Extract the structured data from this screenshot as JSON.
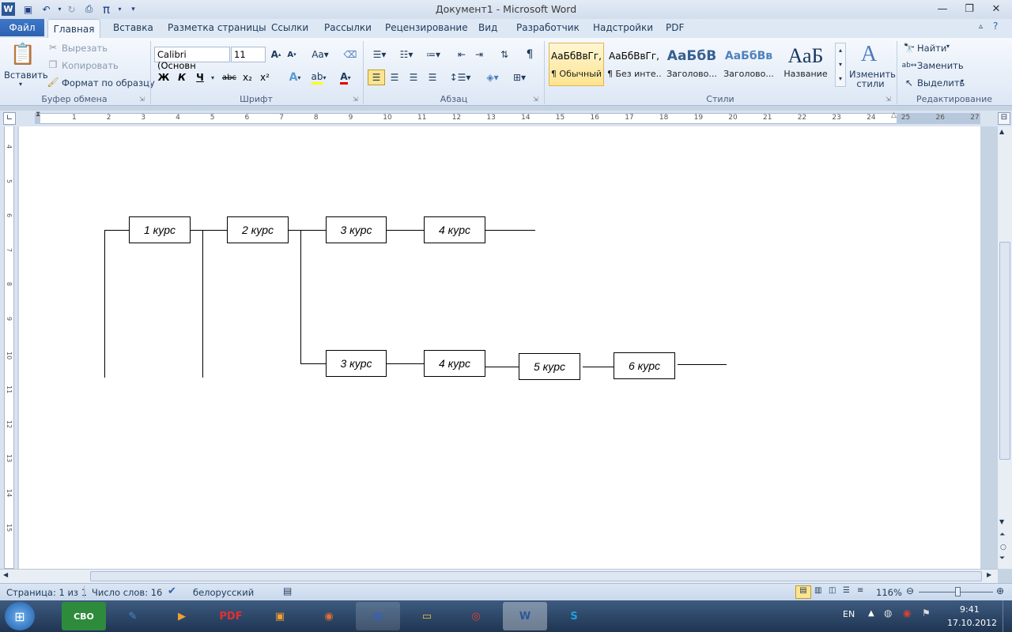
{
  "window": {
    "title": "Документ1  -  Microsoft Word"
  },
  "tabs": [
    "Файл",
    "Главная",
    "Вставка",
    "Разметка страницы",
    "Ссылки",
    "Рассылки",
    "Рецензирование",
    "Вид",
    "Разработчик",
    "Надстройки",
    "PDF"
  ],
  "ribbon": {
    "clipboard": {
      "paste": "Вставить",
      "cut": "Вырезать",
      "copy": "Копировать",
      "format_painter": "Формат по образцу",
      "label": "Буфер обмена"
    },
    "font": {
      "name": "Calibri (Основн",
      "size": "11",
      "label": "Шрифт",
      "bold": "Ж",
      "italic": "К",
      "underline": "Ч",
      "strike": "abc",
      "sub": "x₂",
      "sup": "x²"
    },
    "paragraph": {
      "label": "Абзац"
    },
    "styles": {
      "label": "Стили",
      "items": [
        {
          "sample": "АаБбВвГг,",
          "name": "¶ Обычный"
        },
        {
          "sample": "АаБбВвГг,",
          "name": "¶ Без инте..."
        },
        {
          "sample": "АаБбВ",
          "name": "Заголово..."
        },
        {
          "sample": "АаБбВв",
          "name": "Заголово..."
        },
        {
          "sample": "АаБ",
          "name": "Название"
        }
      ],
      "change": "Изменить стили"
    },
    "editing": {
      "find": "Найти",
      "replace": "Заменить",
      "select": "Выделить",
      "label": "Редактирование"
    }
  },
  "ruler": {
    "numbers": [
      "1",
      "2",
      "3",
      "4",
      "5",
      "6",
      "7",
      "8",
      "9",
      "10",
      "11",
      "12",
      "13",
      "14",
      "15",
      "16",
      "17",
      "18",
      "19",
      "20",
      "21",
      "22",
      "23",
      "24",
      "25",
      "26",
      "27"
    ]
  },
  "vruler": {
    "numbers": [
      "4",
      "5",
      "6",
      "7",
      "8",
      "9",
      "10",
      "11",
      "12",
      "13",
      "14",
      "15"
    ]
  },
  "diagram": {
    "boxes": [
      {
        "label": "1 курс"
      },
      {
        "label": "2 курс"
      },
      {
        "label": "3 курс"
      },
      {
        "label": "4 курс"
      },
      {
        "label": "3 курс"
      },
      {
        "label": "4 курс"
      },
      {
        "label": "5 курс"
      },
      {
        "label": "6 курс"
      }
    ]
  },
  "status": {
    "page": "Страница: 1 из 1",
    "words": "Число слов: 16",
    "lang": "белорусский",
    "zoom": "116%"
  },
  "taskbar": {
    "lang": "EN",
    "time": "9:41",
    "date": "17.10.2012"
  }
}
